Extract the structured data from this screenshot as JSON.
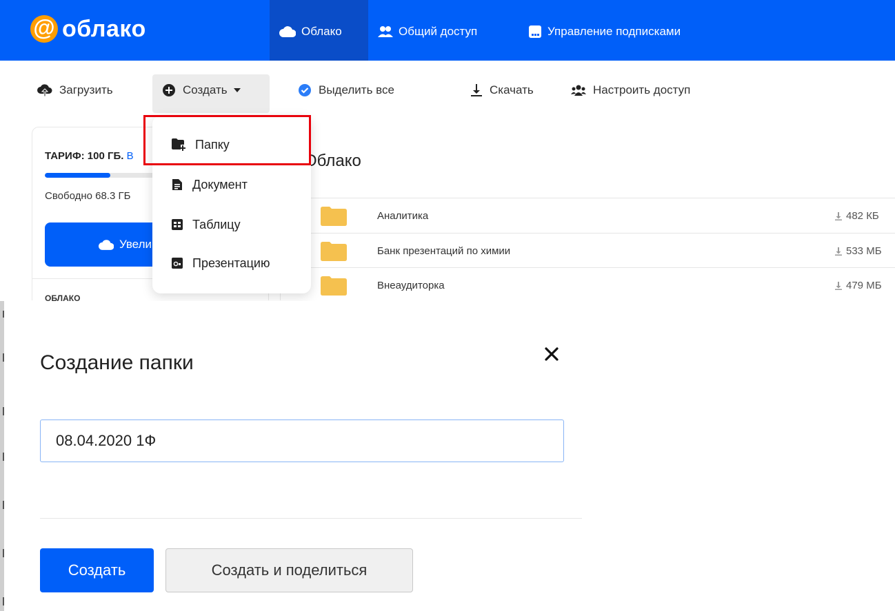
{
  "header": {
    "logo_text": "облако",
    "nav": [
      {
        "label": "Облако",
        "icon": "cloud-icon",
        "active": true
      },
      {
        "label": "Общий доступ",
        "icon": "people-icon"
      },
      {
        "label": "Управление подписками",
        "icon": "subscriptions-icon"
      }
    ]
  },
  "toolbar": {
    "upload": "Загрузить",
    "create": "Создать",
    "select_all": "Выделить все",
    "download": "Скачать",
    "access": "Настроить доступ"
  },
  "dropdown": {
    "items": [
      {
        "label": "Папку",
        "icon": "folder-add-icon",
        "highlighted": true
      },
      {
        "label": "Документ",
        "icon": "document-icon"
      },
      {
        "label": "Таблицу",
        "icon": "table-icon"
      },
      {
        "label": "Презентацию",
        "icon": "presentation-icon"
      }
    ]
  },
  "sidebar": {
    "tariff_label": "ТАРИФ: 100 ГБ.",
    "tariff_link": "В",
    "storage_used_fraction": 0.317,
    "free_text": "Свободно 68.3 ГБ",
    "increase_button": "Увеличить",
    "section_label": "ОБЛАКО"
  },
  "main": {
    "title": "Облако",
    "files": [
      {
        "name": "Аналитика",
        "size": "482 КБ"
      },
      {
        "name": "Банк презентаций по химии",
        "size": "533 МБ"
      },
      {
        "name": "Внеаудиторка",
        "size": "479 МБ"
      }
    ]
  },
  "dialog": {
    "title": "Создание папки",
    "input_value": "08.04.2020 1Ф",
    "create_button": "Создать",
    "create_share_button": "Создать и поделиться"
  },
  "colors": {
    "brand_blue": "#005ff9",
    "logo_orange": "#ff9e00",
    "highlight_red": "#e8000b",
    "folder_yellow": "#f5c14f"
  }
}
